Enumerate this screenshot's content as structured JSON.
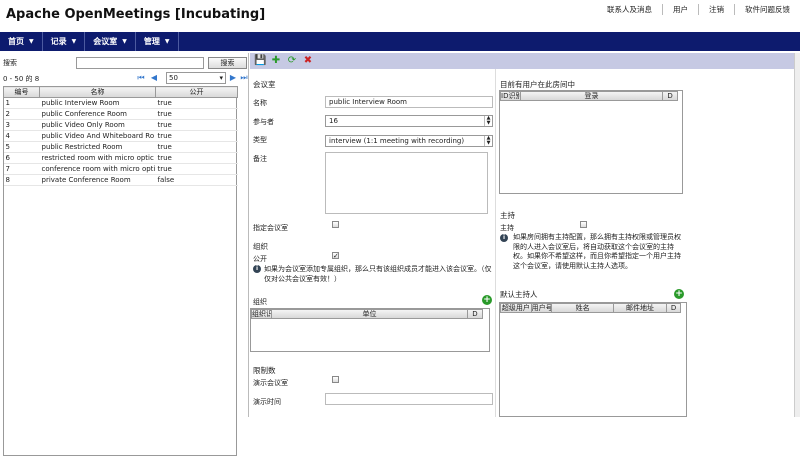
{
  "app": {
    "title": "Apache OpenMeetings [Incubating]"
  },
  "toplinks": [
    "联系人及消息",
    "用户",
    "注销",
    "软件问题反馈"
  ],
  "nav": [
    {
      "label": "首页"
    },
    {
      "label": "记录"
    },
    {
      "label": "会议室"
    },
    {
      "label": "管理"
    }
  ],
  "search": {
    "label": "搜索",
    "value": "",
    "button": "搜索"
  },
  "pager": {
    "range": "0 - 50 的 8",
    "page_size": "50"
  },
  "grid": {
    "columns": [
      "编号",
      "名称",
      "公开"
    ],
    "rows": [
      [
        "1",
        "public Interview Room",
        "true"
      ],
      [
        "2",
        "public Conference Room",
        "true"
      ],
      [
        "3",
        "public Video Only Room",
        "true"
      ],
      [
        "4",
        "public Video And Whiteboard Ro",
        "true"
      ],
      [
        "5",
        "public Restricted Room",
        "true"
      ],
      [
        "6",
        "restricted room with micro optic",
        "true"
      ],
      [
        "7",
        "conference room with micro opti",
        "true"
      ],
      [
        "8",
        "private Conference Room",
        "false"
      ]
    ]
  },
  "form": {
    "section_title": "会议室",
    "name_label": "名称",
    "name_value": "public Interview Room",
    "participants_label": "参与者",
    "participants_value": "16",
    "type_label": "类型",
    "type_value": "interview  (1:1 meeting with recording)",
    "comment_label": "备注",
    "appointment_label": "指定会议室",
    "org_section": "组织",
    "public_label": "公开",
    "public_note": "如果为会议室添加专属组织，那么只有该组织成员才能进入该会议室。（仅仅对公共会议室有效！）",
    "org_label": "组织",
    "org_columns": [
      "组织识别",
      "单位",
      "D"
    ],
    "limits_section": "限制数",
    "demo_room_label": "演示会议室",
    "demo_time_label": "演示时间"
  },
  "right": {
    "current_users_title": "目前有用户在此房间中",
    "current_cols": [
      "ID识别",
      "登录",
      "D"
    ],
    "moderator_section": "主持",
    "moderator_label": "主持",
    "moderator_note": "如果房间拥有主持配置，那么拥有主持权限或管理员权限的人进入会议室后，将自动获取这个会议室的主持权。如果你不希望这样，而且你希望指定一个用户主持这个会议室，请使用默认主持人选项。",
    "default_mod_title": "默认主持人",
    "default_mod_cols": [
      "超级用户",
      "用户号",
      "姓名",
      "邮件地址",
      "D"
    ]
  }
}
